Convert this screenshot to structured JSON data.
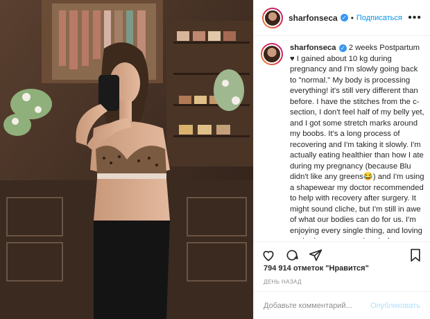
{
  "header": {
    "username": "sharfonseca",
    "follow_label": "Подписаться",
    "dot": "•"
  },
  "caption": {
    "username": "sharfonseca",
    "text_head": " 2 weeks Postpartum ♥ I gained about 10 kg during pregnancy and I'm slowly going back to \"normal.\" My body is processing everything! it's still very different than before. I have the stitches from the c-section, I don't feel half of my belly yet, and I got some stretch marks around my boobs. It's a long process of recovering and I'm taking it slowly. I'm actually eating healthier than how I ate during my pregnancy (because Blu didn't like any greens😂) and I'm using a shapewear my doctor recommended to help with recovery after surgery. It might sound cliche, but I'm still in awe of what our bodies can do for us. I'm enjoying every single thing, and loving my body even more than before."
  },
  "likes": {
    "text": "794 914 отметок \"Нравится\""
  },
  "timestamp": {
    "text": "ДЕНЬ НАЗАД"
  },
  "comment": {
    "placeholder": "Добавьте комментарий...",
    "publish_label": "Опубликовать"
  },
  "icons": [
    "heart-icon",
    "comment-icon",
    "share-icon",
    "bookmark-icon",
    "more-icon",
    "verified-icon"
  ],
  "colors": {
    "accent": "#0095f6",
    "verified": "#3897f0",
    "muted": "#8e8e8e"
  }
}
